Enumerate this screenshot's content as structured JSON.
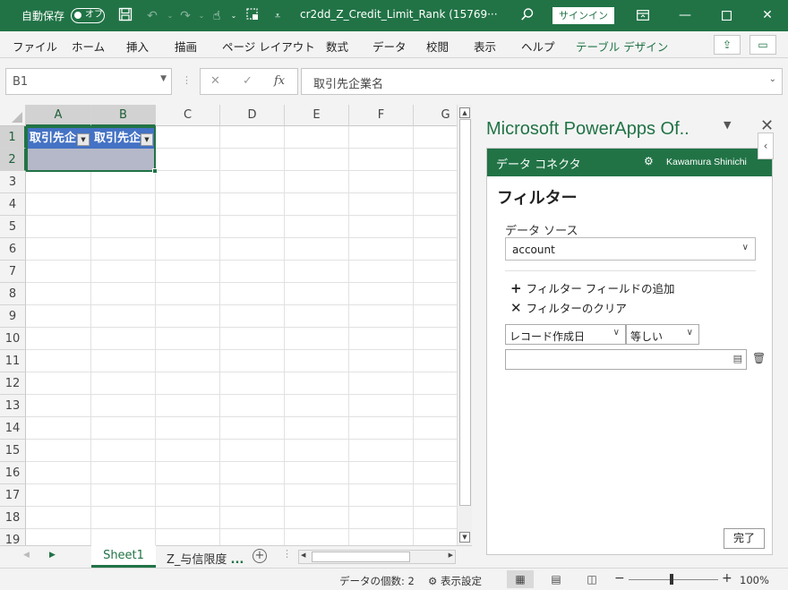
{
  "titlebar": {
    "autosave_label": "自動保存",
    "autosave_state": "オフ",
    "filename": "cr2dd_Z_Credit_Limit_Rank (15769···",
    "signin_label": "サインイン",
    "icons": [
      "save-icon",
      "undo-icon",
      "redo-icon",
      "touch-mode-icon",
      "screenshot-icon",
      "customize-qat-icon",
      "search-icon",
      "ribbon-display-icon",
      "minimize-icon",
      "maximize-icon",
      "close-icon"
    ]
  },
  "ribbon": {
    "tabs": [
      "ファイル",
      "ホーム",
      "挿入",
      "描画",
      "ページ レイアウト",
      "数式",
      "データ",
      "校閲",
      "表示",
      "ヘルプ",
      "テーブル デザイン"
    ]
  },
  "formula_bar": {
    "namebox": "B1",
    "formula": "取引先企業名"
  },
  "grid": {
    "columns": [
      "A",
      "B",
      "C",
      "D",
      "E",
      "F",
      "G"
    ],
    "rows": [
      "1",
      "2",
      "3",
      "4",
      "5",
      "6",
      "7",
      "8",
      "9",
      "10",
      "11",
      "12",
      "13",
      "14",
      "15",
      "16",
      "17",
      "18",
      "19"
    ],
    "table_headers": [
      "取引先企",
      "取引先企"
    ]
  },
  "sheets": {
    "active": "Sheet1",
    "other": "Z_与信限度",
    "more": "..."
  },
  "status": {
    "count_label": "データの個数: 2",
    "display_settings": "表示設定",
    "zoom": "100%",
    "zoom_minus": "−",
    "zoom_plus": "+"
  },
  "pane": {
    "title": "Microsoft PowerApps Of..",
    "header_title": "データ コネクタ",
    "user": "Kawamura Shinichi",
    "filter_title": "フィルター",
    "datasource_label": "データ ソース",
    "datasource_value": "account",
    "add_field": "フィルター フィールドの追加",
    "clear_filter": "フィルターのクリア",
    "field_select": "レコード作成日",
    "operator_select": "等しい",
    "done_button": "完了"
  }
}
